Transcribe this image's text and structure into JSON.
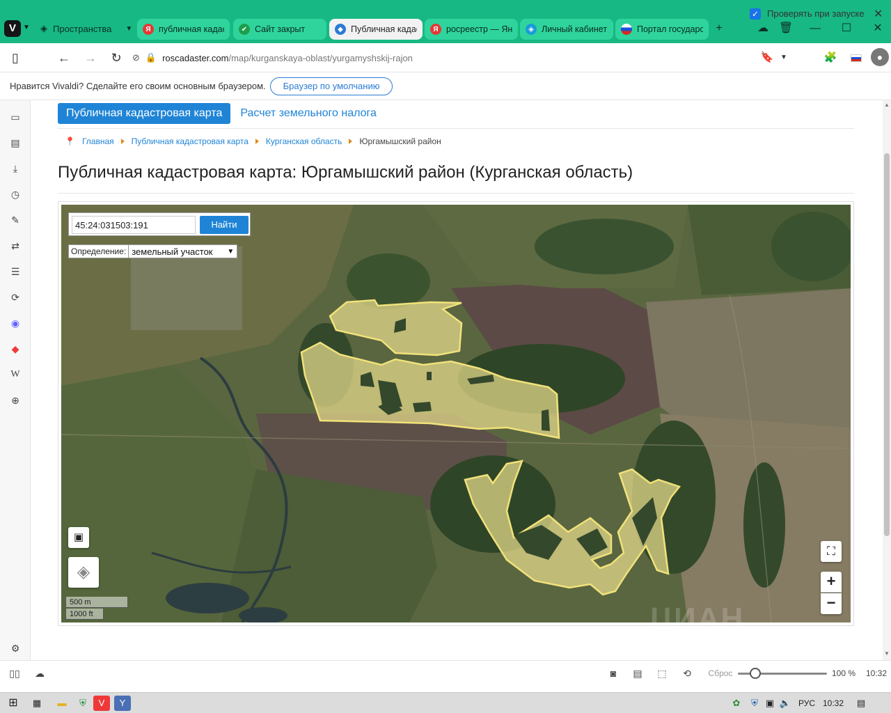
{
  "browser": {
    "spaces_label": "Пространства",
    "tabs": [
      {
        "label": "публичная кадастр",
        "fav_color": "#e53935",
        "fav_char": "Я"
      },
      {
        "label": "Сайт закрыт",
        "fav_color": "#1e9e4b",
        "fav_char": "✔"
      },
      {
        "label": "Публичная кадаст",
        "fav_color": "#2b7bd5",
        "fav_char": "◆",
        "active": true
      },
      {
        "label": "росреестр — Янде",
        "fav_color": "#e53935",
        "fav_char": "Я"
      },
      {
        "label": "Личный кабинет",
        "fav_color": "#1a9bd7",
        "fav_char": "◈"
      },
      {
        "label": "Портал государств",
        "fav_color": "#d52b1e",
        "fav_char": "●"
      }
    ],
    "url_host": "roscadaster.com",
    "url_path": "/map/kurganskaya-oblast/yurgamyshskij-rajon"
  },
  "notification": {
    "text": "Нравится Vivaldi? Сделайте его своим основным браузером.",
    "default_button": "Браузер по умолчанию",
    "checkbox_label": "Проверять при запуске"
  },
  "page": {
    "nav_primary": "Публичная кадастровая карта",
    "nav_secondary": "Расчет земельного налога",
    "breadcrumbs": [
      "Главная",
      "Публичная кадастровая карта",
      "Курганская область"
    ],
    "breadcrumb_current": "Юргамышский район",
    "title": "Публичная кадастровая карта: Юргамышский район (Курганская область)"
  },
  "map": {
    "search_value": "45:24:031503:191",
    "search_button": "Найти",
    "definition_label": "Определение:",
    "definition_value": "земельный участок",
    "scale_metric": "500 m",
    "scale_imperial": "1000 ft",
    "zoom_in": "+",
    "zoom_out": "−",
    "watermark": "ЦИАН",
    "parcel_color": "#e8dc8c"
  },
  "status": {
    "reset_label": "Сброс",
    "zoom_percent": "100 %",
    "zoom_level": 0.18,
    "clock": "10:32"
  },
  "taskbar": {
    "lang": "РУС",
    "time": "10:32"
  }
}
